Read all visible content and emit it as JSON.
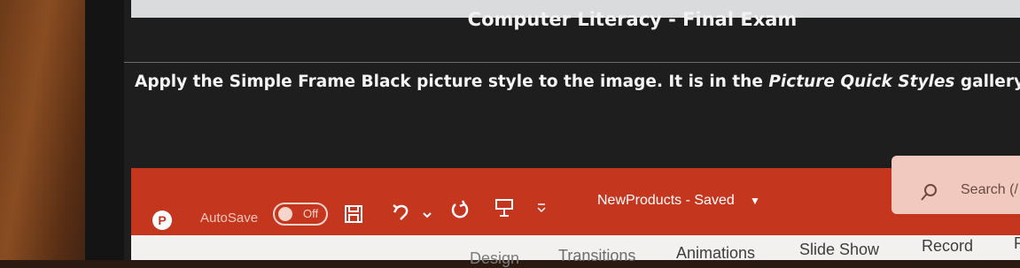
{
  "exam": {
    "title": "Computer Literacy - Final Exam",
    "instruction": {
      "prefix": "Apply the ",
      "style_name": "Simple Frame Black",
      "middle": " picture style to the image. It is in the ",
      "gallery_name": "Picture Quick Styles",
      "suffix": " gallery."
    }
  },
  "titlebar": {
    "autosave_label": "AutoSave",
    "autosave_state": "Off",
    "document_title": "NewProducts - Saved",
    "search_placeholder": "Search (/"
  },
  "tabs": [
    "Design",
    "Transitions",
    "Animations",
    "Slide Show",
    "Record",
    "R"
  ],
  "colors": {
    "ribbon": "#c5361f",
    "screen": "#1e1e1f",
    "text": "#f2f2f2"
  }
}
